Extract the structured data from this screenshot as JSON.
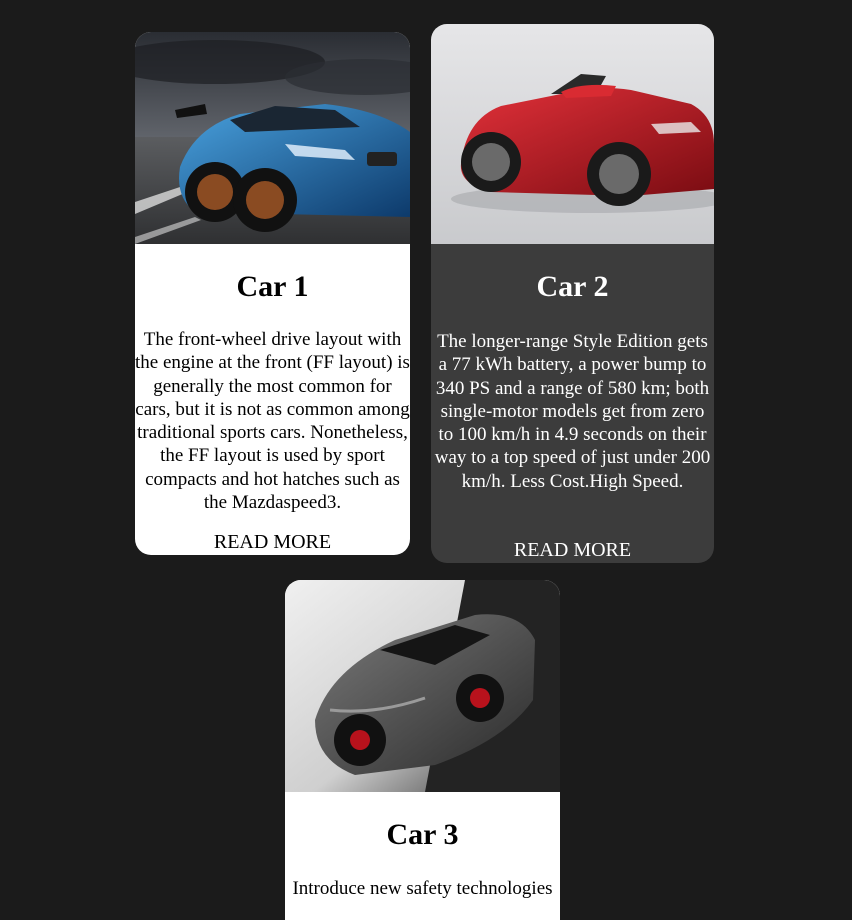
{
  "cards": [
    {
      "title": "Car 1",
      "image": "blue-sports-car-photo",
      "text": "The front-wheel drive layout with the engine at the front (FF layout) is generally the most common for cars, but it is not as common among traditional sports cars. Nonetheless, the FF layout is used by sport compacts and hot hatches such as the Mazdaspeed3.",
      "read_more": "READ MORE"
    },
    {
      "title": "Car 2",
      "image": "red-convertible-photo",
      "text": "The longer-range Style Edition gets a 77 kWh battery, a power bump to 340 PS and a range of 580 km; both single-motor models get from zero to 100 km/h in 4.9 seconds on their way to a top speed of just under 200 km/h. Less Cost.High Speed.",
      "read_more": "READ MORE"
    },
    {
      "title": "Car 3",
      "image": "grey-supercar-photo",
      "text": "Introduce new safety technologies"
    }
  ],
  "colors": {
    "page_background": "#1b1b1b",
    "card_light": "#ffffff",
    "card_dark": "#3c3c3c"
  }
}
